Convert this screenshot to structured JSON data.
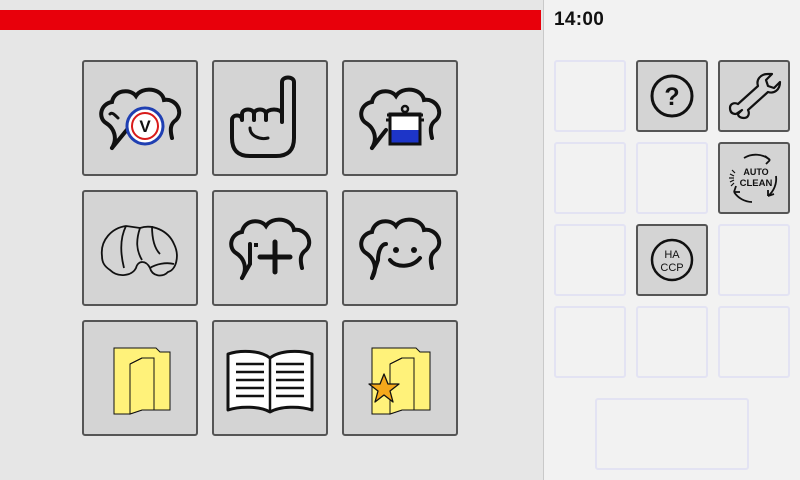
{
  "header": {
    "time": "14:00"
  },
  "colors": {
    "accent_bar": "#e8000b",
    "tile_bg": "#d4d4d4",
    "folder_yellow": "#fff27a",
    "star": "#f5a81b",
    "verified_ring": "#1f3fb2",
    "verified_inner": "#d81b1b"
  },
  "main_tiles": [
    {
      "icon": "chef-hat-verified-icon",
      "badge": "V"
    },
    {
      "icon": "hand-pointing-icon"
    },
    {
      "icon": "chef-hat-pot-icon"
    },
    {
      "icon": "croissant-icon"
    },
    {
      "icon": "chef-hat-plus-icon"
    },
    {
      "icon": "chef-hat-smile-icon"
    },
    {
      "icon": "folder-icon"
    },
    {
      "icon": "open-book-icon"
    },
    {
      "icon": "folder-star-icon"
    }
  ],
  "side_buttons": {
    "help": {
      "icon": "help-icon",
      "label": "?"
    },
    "service": {
      "icon": "wrench-icon"
    },
    "autoclean": {
      "icon": "autoclean-icon",
      "line1": "AUTO",
      "line2": "CLEAN"
    },
    "haccp": {
      "icon": "haccp-icon",
      "line1": "HA",
      "line2": "CCP"
    }
  }
}
